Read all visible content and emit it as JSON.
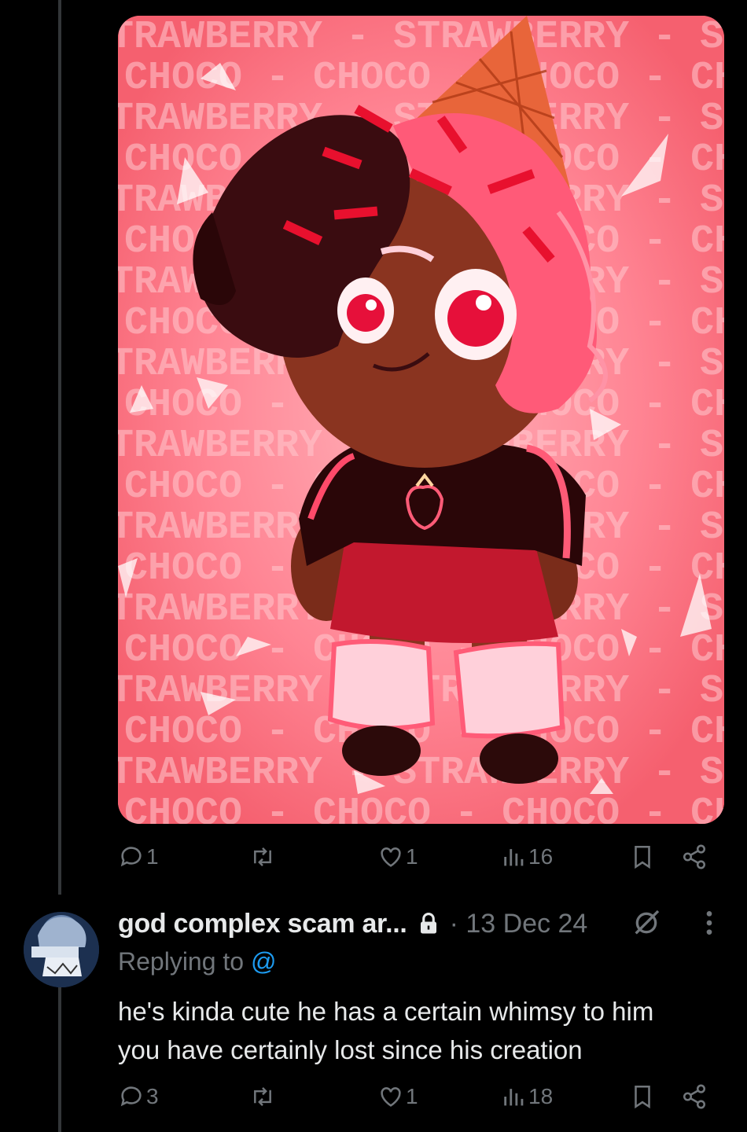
{
  "post": {
    "artwork": {
      "description_icon": "cookie-character-artwork",
      "pattern_words": [
        "STRAWBERRY",
        "CHOCO"
      ],
      "colors": {
        "background": "#ff7f8e",
        "hair_pink": "#ff5a78",
        "hair_dark": "#3a0c10",
        "skin": "#8a3420",
        "shirt": "#2a0608",
        "skirt": "#c2182e"
      }
    },
    "actions": {
      "reply_count": "1",
      "repost_count": "",
      "like_count": "1",
      "views_count": "16"
    }
  },
  "reply": {
    "author": "god complex scam ar...",
    "timestamp": "· 13 Dec 24",
    "replying_prefix": "Replying to",
    "replying_handle": "@",
    "text_line1": "he's kinda cute he has a certain whimsy to him",
    "text_line2": "you have certainly lost since his creation",
    "actions": {
      "reply_count": "3",
      "repost_count": "",
      "like_count": "1",
      "views_count": "18"
    }
  },
  "colors": {
    "muted": "#71767b",
    "text": "#e7e9ea",
    "link": "#1d9bf0",
    "background": "#000000"
  }
}
